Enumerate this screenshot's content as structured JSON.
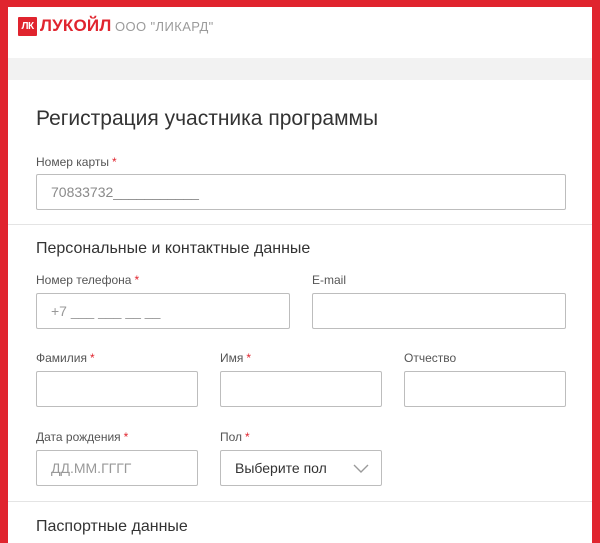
{
  "header": {
    "logo_mark": "ЛК",
    "logo_text": "ЛУКОЙЛ",
    "company": "ООО \"ЛИКАРД\"",
    "brand_color": "#e0242e"
  },
  "form": {
    "title": "Регистрация участника программы",
    "card_number": {
      "label": "Номер карты",
      "value": "70833732___________"
    },
    "personal": {
      "title": "Персональные и контактные данные",
      "phone": {
        "label": "Номер телефона",
        "placeholder": "+7 ___ ___ __ __"
      },
      "email": {
        "label": "E-mail",
        "value": ""
      },
      "last_name": {
        "label": "Фамилия",
        "value": ""
      },
      "first_name": {
        "label": "Имя",
        "value": ""
      },
      "patronymic": {
        "label": "Отчество",
        "value": ""
      },
      "birth_date": {
        "label": "Дата рождения",
        "placeholder": "ДД.ММ.ГГГГ"
      },
      "gender": {
        "label": "Пол",
        "selected": "Выберите пол",
        "icon": "chevron-down-icon"
      }
    },
    "passport": {
      "title": "Паспортные данные"
    },
    "required_marker": "*"
  }
}
